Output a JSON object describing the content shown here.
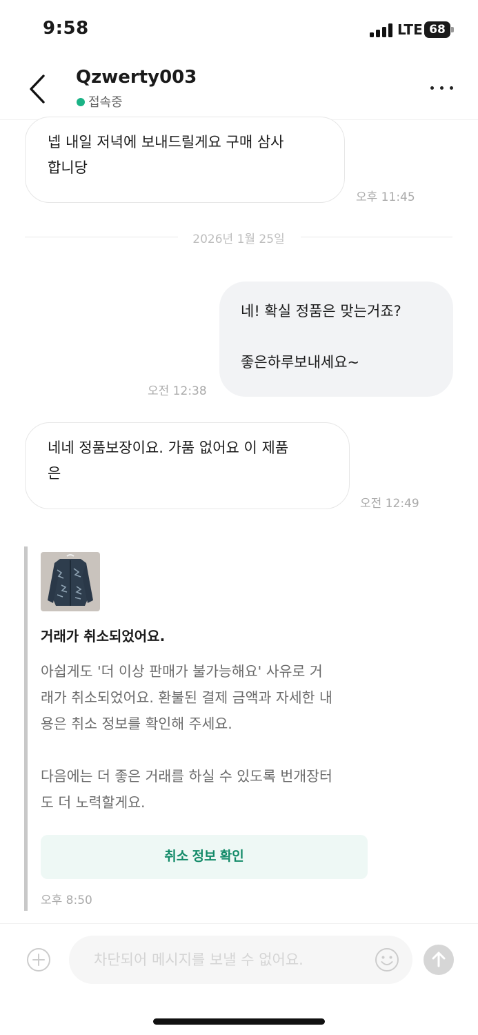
{
  "status_bar": {
    "time": "9:58",
    "network": "LTE",
    "battery": "68"
  },
  "header": {
    "peer_name": "Qzwerty003",
    "presence": "접속중",
    "presence_color": "#1bb386"
  },
  "messages": [
    {
      "direction": "in",
      "lines": [
        "넵 내일 저녁에 보내드릴게요 구매 삼사",
        "합니당"
      ],
      "time": "오후 11:45"
    },
    {
      "direction": "out",
      "lines": [
        "네! 확실 정품은 맞는거죠?",
        "",
        "좋은하루보내세요~"
      ],
      "time": "오전 12:38"
    },
    {
      "direction": "in",
      "lines": [
        "네네 정품보장이요. 가품 없어요 이 제품",
        "은"
      ],
      "time": "오전 12:49"
    }
  ],
  "date_divider": "2026년 1월 25일",
  "system_card": {
    "title": "거래가 취소되었어요.",
    "body": "아쉽게도 '더 이상 판매가 불가능해요' 사유로 거\n래가 취소되었어요. 환불된 결제 금액과 자세한 내\n용은 취소 정보를 확인해 주세요.\n\n다음에는 더 좋은 거래를 하실 수 있도록 번개장터\n도 더 노력할게요.",
    "button_label": "취소 정보 확인",
    "time": "오후 8:50",
    "accent_color": "#128a68"
  },
  "input": {
    "placeholder": "차단되어 메시지를 보낼 수 없어요."
  },
  "icons": {
    "back": "chevron-left-icon",
    "more": "more-dots-icon",
    "plus": "plus-circle-icon",
    "emoji": "smiley-icon",
    "send": "arrow-up-icon"
  }
}
